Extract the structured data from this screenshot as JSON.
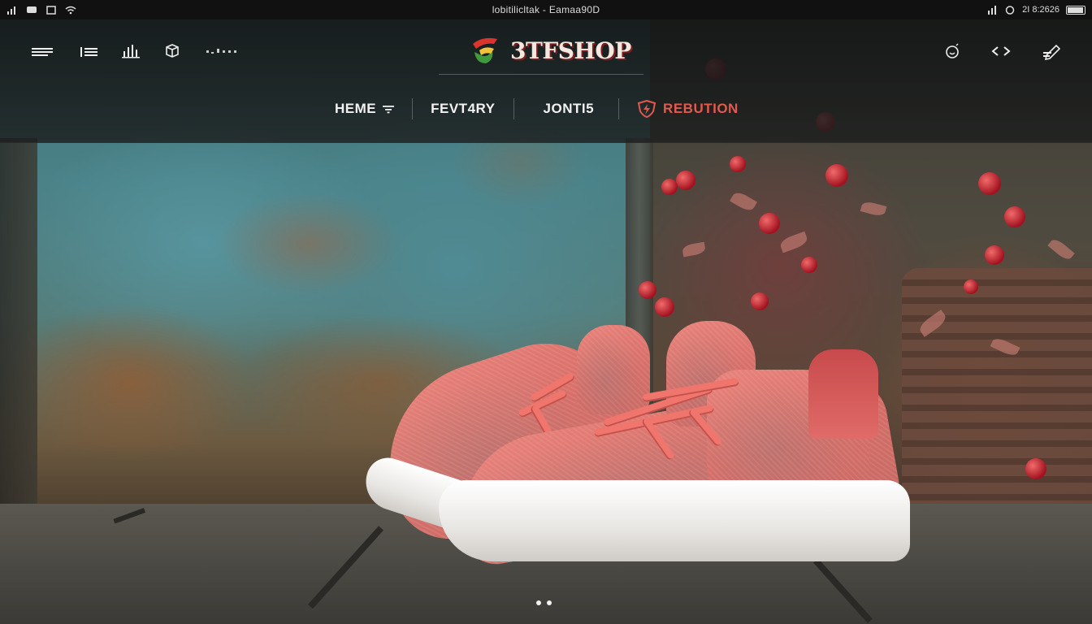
{
  "status_bar": {
    "url": "lobitilicltak - Eamaa90D",
    "time": "2I 8:2626",
    "icons": [
      "signal-icon",
      "message-icon",
      "notification-icon",
      "wifi-icon"
    ],
    "right_icons": [
      "signal-bars-icon",
      "clock-icon",
      "battery-icon"
    ]
  },
  "header": {
    "logo_text": "3TFSHOP",
    "left_icons": [
      "menu-icon",
      "list-icon",
      "chart-icon",
      "cube-icon",
      "dots-icon"
    ],
    "right_icons": [
      "smiley-icon",
      "swap-arrows-icon",
      "edit-icon"
    ]
  },
  "nav": {
    "items": [
      {
        "label": "HEME",
        "has_dropdown": true
      },
      {
        "label": "FEVT4RY"
      },
      {
        "label": "JONTI5"
      },
      {
        "label": "REBUTION",
        "accent": true
      }
    ]
  },
  "carousel": {
    "slides": 2,
    "active": 1
  },
  "colors": {
    "accent": "#e25a4e",
    "header_bg": "#1c1e1e",
    "shoe_pink": "#e07a72"
  }
}
